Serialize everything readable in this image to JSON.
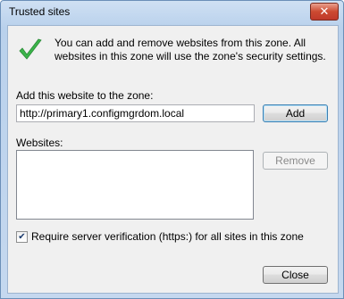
{
  "window": {
    "title": "Trusted sites"
  },
  "icons": {
    "close": "close-icon",
    "check": "checkmark-icon"
  },
  "intro": {
    "text": "You can add and remove websites from this zone. All websites in this zone will use the zone's security settings."
  },
  "add_site": {
    "label": "Add this website to the zone:",
    "value": "http://primary1.configmgrdom.local",
    "button": "Add"
  },
  "websites": {
    "label": "Websites:",
    "items": [],
    "remove_button": "Remove"
  },
  "https_option": {
    "checked": true,
    "label": "Require server verification (https:) for all sites in this zone"
  },
  "footer": {
    "close_button": "Close"
  },
  "colors": {
    "check_green": "#3bb44a",
    "close_red": "#c0392b"
  }
}
